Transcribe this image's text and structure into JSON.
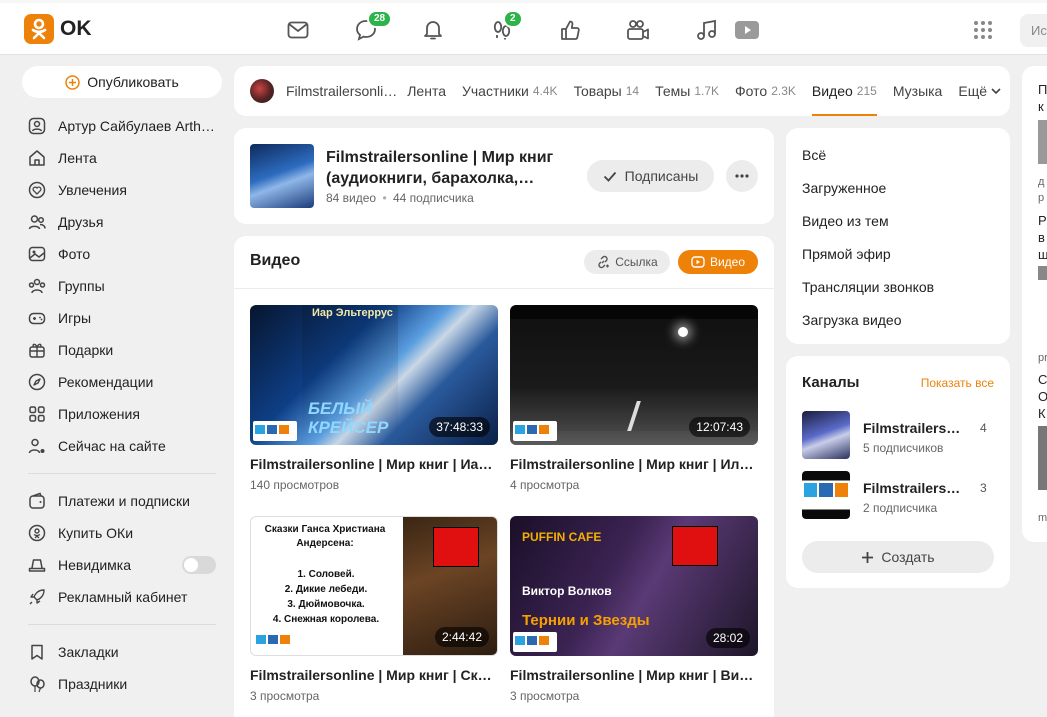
{
  "header": {
    "logo_text": "OK",
    "badges": {
      "messages": "28",
      "guests": "2"
    },
    "search_placeholder": "Ис"
  },
  "leftnav": {
    "publish": "Опубликовать",
    "items": [
      "Артур Сайбулаев Arth…",
      "Лента",
      "Увлечения",
      "Друзья",
      "Фото",
      "Группы",
      "Игры",
      "Подарки",
      "Рекомендации",
      "Приложения",
      "Сейчас на сайте"
    ],
    "items2": [
      "Платежи и подписки",
      "Купить ОКи",
      "Невидимка",
      "Рекламный кабинет"
    ],
    "items3": [
      "Закладки",
      "Праздники"
    ]
  },
  "tabs": {
    "group_name": "Filmstrailersonli…",
    "items": [
      {
        "label": "Лента",
        "count": ""
      },
      {
        "label": "Участники",
        "count": "4.4K"
      },
      {
        "label": "Товары",
        "count": "14"
      },
      {
        "label": "Темы",
        "count": "1.7K"
      },
      {
        "label": "Фото",
        "count": "2.3K"
      },
      {
        "label": "Видео",
        "count": "215"
      },
      {
        "label": "Музыка",
        "count": ""
      },
      {
        "label": "Ещё",
        "count": ""
      }
    ]
  },
  "group": {
    "title": "Filmstrailersonline | Мир книг (аудиокниги, барахолка,…",
    "videos": "84 видео",
    "dot": "•",
    "subscribers": "44 подписчика",
    "subscribed": "Подписаны"
  },
  "video_section": {
    "title": "Видео",
    "link": "Ссылка",
    "video_btn": "Видео",
    "videos": [
      {
        "title": "Filmstrailersonline | Мир книг | Иа…",
        "views": "140 просмотров",
        "duration": "37:48:33",
        "cover_text": "Иар Эльтеррус",
        "cover_text2": "БЕЛЫЙ КРЕЙСЕР"
      },
      {
        "title": "Filmstrailersonline | Мир книг | Ил…",
        "views": "4 просмотра",
        "duration": "12:07:43"
      },
      {
        "title": "Filmstrailersonline | Мир книг | Ск…",
        "views": "3 просмотра",
        "duration": "2:44:42",
        "cover_text": "Сказки Ганса Христиана Андерсена:",
        "list": [
          "1. Соловей.",
          "2. Дикие лебеди.",
          "3. Дюймовочка.",
          "4. Снежная королева."
        ]
      },
      {
        "title": "Filmstrailersonline | Мир книг | Ви…",
        "views": "3 просмотра",
        "duration": "28:02",
        "cover_text": "PUFFIN CAFE",
        "cover_text2": "Виктор Волков",
        "cover_text3": "Тернии и Звезды"
      }
    ]
  },
  "video_menu": [
    "Всё",
    "Загруженное",
    "Видео из тем",
    "Прямой эфир",
    "Трансляции звонков",
    "Загрузка видео"
  ],
  "channels": {
    "title": "Каналы",
    "show_all": "Показать все",
    "items": [
      {
        "name": "Filmstrailers…",
        "subs": "5 подписчиков",
        "count": "4"
      },
      {
        "name": "Filmstrailers…",
        "subs": "2 подписчика",
        "count": "3"
      }
    ],
    "create": "Создать"
  },
  "farright": {
    "lines": [
      "П",
      "к",
      "д",
      "р",
      "Р",
      "в",
      "ш",
      "pr",
      "С",
      "О",
      "К",
      "m"
    ]
  },
  "colors": {
    "accent": "#ee8208",
    "badge": "#2cb34a"
  }
}
